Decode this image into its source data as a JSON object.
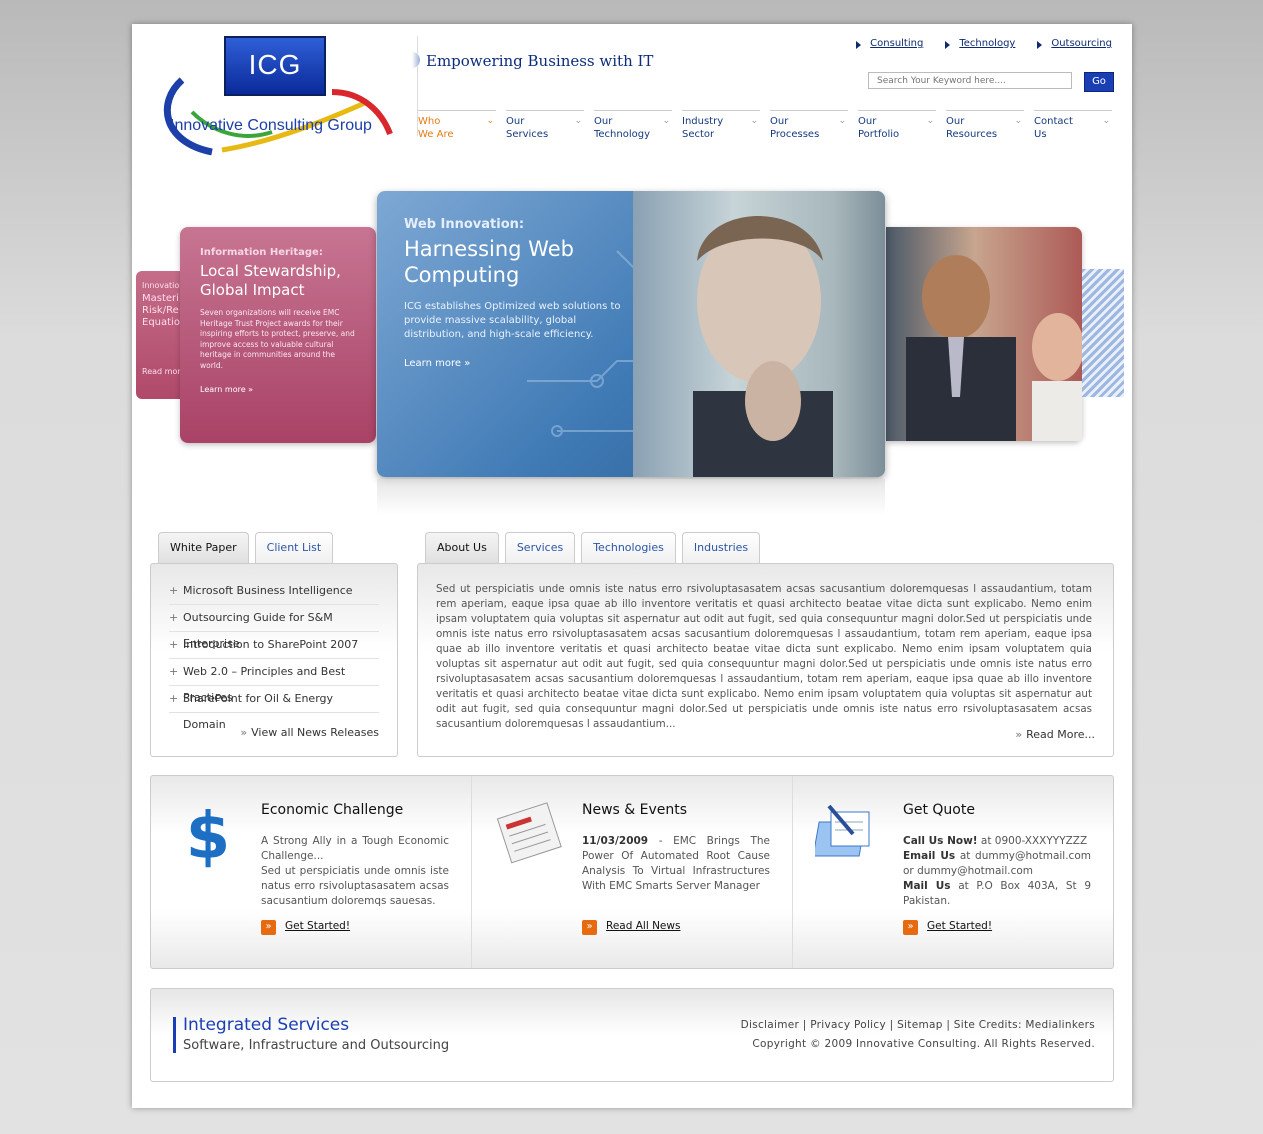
{
  "header": {
    "logo_abbr": "ICG",
    "logo_name": "Innovative Consulting Group",
    "tagline": "Empowering Business with IT",
    "top_links": [
      "Consulting",
      "Technology",
      "Outsourcing"
    ],
    "search_placeholder": "Search Your Keyword here....",
    "search_button": "Go"
  },
  "nav": [
    {
      "line1": "Who",
      "line2": "We Are"
    },
    {
      "line1": "Our",
      "line2": "Services"
    },
    {
      "line1": "Our",
      "line2": "Technology"
    },
    {
      "line1": "Industry",
      "line2": "Sector"
    },
    {
      "line1": "Our",
      "line2": "Processes"
    },
    {
      "line1": "Our",
      "line2": "Portfolio"
    },
    {
      "line1": "Our",
      "line2": "Resources"
    },
    {
      "line1": "Contact",
      "line2": "Us"
    }
  ],
  "banner": {
    "far_left": {
      "kicker": "Innovation",
      "lines": [
        "Masteri",
        "Risk/Re",
        "Equatio"
      ],
      "learn": "Read more"
    },
    "left": {
      "kicker": "Information Heritage:",
      "title": "Local Stewardship, Global Impact",
      "desc": "Seven organizations will receive EMC Heritage Trust Project awards for their inspiring efforts to protect, preserve, and improve access to valuable cultural heritage in communities around the world.",
      "learn": "Learn more"
    },
    "center": {
      "kicker": "Web Innovation:",
      "title": "Harnessing Web Computing",
      "desc": "ICG establishes Optimized web solutions to provide massive scalability, global distribution, and high-scale efficiency.",
      "learn": "Learn more"
    }
  },
  "left_tabs": {
    "tabs": [
      "White Paper",
      "Client List"
    ],
    "items": [
      "Microsoft Business Intelligence",
      "Outsourcing Guide for S&M Enterprise",
      "Introduction to SharePoint 2007",
      "Web 2.0 – Principles and Best Practices",
      "SharePoint for Oil & Energy Domain"
    ],
    "view_all": "View all News Releases"
  },
  "right_tabs": {
    "tabs": [
      "About Us",
      "Services",
      "Technologies",
      "Industries"
    ],
    "text": "Sed ut perspiciatis unde omnis iste natus erro rsivoluptasasatem acsas sacusantium doloremquesas l assaudantium, totam rem aperiam, eaque ipsa quae ab illo inventore veritatis et quasi architecto beatae vitae dicta sunt explicabo. Nemo enim ipsam voluptatem quia voluptas sit aspernatur aut odit aut fugit, sed quia consequuntur magni dolor.Sed ut perspiciatis unde omnis iste natus erro rsivoluptasasatem acsas sacusantium doloremquesas l assaudantium, totam rem aperiam, eaque ipsa quae ab illo inventore veritatis et quasi architecto beatae vitae dicta sunt explicabo. Nemo enim ipsam voluptatem quia voluptas sit aspernatur aut odit aut fugit, sed quia consequuntur magni dolor.Sed ut perspiciatis unde omnis iste natus erro rsivoluptasasatem acsas sacusantium doloremquesas l assaudantium, totam rem aperiam, eaque ipsa quae ab illo inventore veritatis et quasi architecto beatae vitae dicta sunt explicabo. Nemo enim ipsam voluptatem quia voluptas sit aspernatur aut odit aut fugit, sed quia consequuntur magni dolor.Sed ut perspiciatis unde omnis iste natus erro rsivoluptasasatem acsas sacusantium doloremquesas l assaudantium...",
    "read_more": "Read More..."
  },
  "features": {
    "economic": {
      "title": "Economic Challenge",
      "lead": "A Strong Ally in a Tough Economic Challenge...",
      "body": "Sed ut perspiciatis unde omnis iste natus erro rsivoluptasasatem acsas sacusantium doloremqs sauesas.",
      "cta": "Get Started!"
    },
    "news": {
      "title": "News & Events",
      "date": "11/03/2009",
      "body": " - EMC Brings The Power Of Automated Root Cause Analysis To Virtual Infrastructures With EMC Smarts Server Manager",
      "cta": "Read All News"
    },
    "quote": {
      "title": "Get Quote",
      "call_label": "Call Us Now!",
      "call_value": " at 0900-XXXYYYZZZ",
      "email_label": "Email Us",
      "email_value": " at dummy@hotmail.com or dummy@hotmail.com",
      "mail_label": "Mail Us",
      "mail_value": " at P.O Box 403A, St 9 Pakistan.",
      "cta": "Get Started!"
    }
  },
  "footer": {
    "title": "Integrated Services",
    "subtitle": "Software, Infrastructure and Outsourcing",
    "links": "Disclaimer | Privacy Policy | Sitemap | Site Credits: Medialinkers",
    "copyright": "Copyright © 2009 Innovative Consulting. All Rights Reserved."
  },
  "colors": {
    "brand_blue": "#1a3fb5",
    "nav_active": "#e67a10",
    "cta_orange": "#e86a10"
  }
}
